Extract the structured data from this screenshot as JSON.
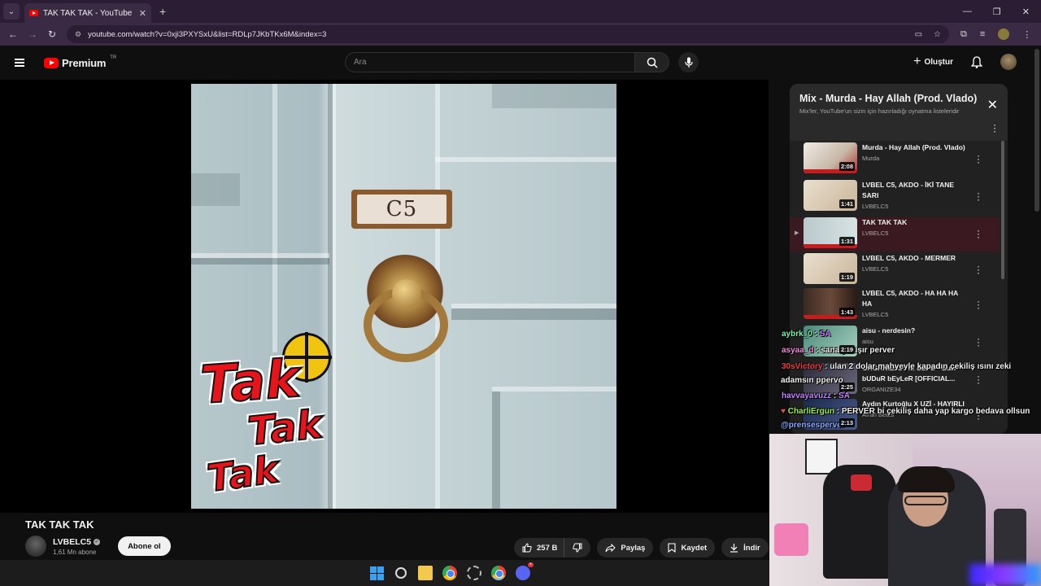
{
  "browser": {
    "tab_title": "TAK TAK TAK - YouTube",
    "url": "youtube.com/watch?v=0xji3PXYSxU&list=RDLp7JKbTKx6M&index=3"
  },
  "header": {
    "logo_text": "Premium",
    "logo_region": "TR",
    "search_placeholder": "Ara",
    "create_label": "Oluştur"
  },
  "cover": {
    "plate_text": "C5",
    "sticker_words": [
      "Tak",
      "Tak",
      "Tak"
    ]
  },
  "video": {
    "title": "TAK TAK TAK",
    "channel": "LVBELC5",
    "subscribers": "1,61 Mn abone",
    "subscribe_label": "Abone ol",
    "likes": "257 B",
    "share_label": "Paylaş",
    "save_label": "Kaydet",
    "download_label": "İndir"
  },
  "playlist": {
    "title": "Mix - Murda - Hay Allah (Prod. Vlado)",
    "subtitle": "Mix'ler, YouTube'un sizin için hazırladığı oynatma listeleridir",
    "items": [
      {
        "title": "Murda - Hay Allah (Prod. Vlado)",
        "channel": "Murda",
        "duration": "2:08"
      },
      {
        "title": "LVBEL C5, AKDO - İKİ TANE SARI",
        "channel": "LVBELC5",
        "duration": "1:41"
      },
      {
        "title": "TAK TAK TAK",
        "channel": "LVBELC5",
        "duration": "1:31"
      },
      {
        "title": "LVBEL C5, AKDO - MERMER",
        "channel": "LVBELC5",
        "duration": "1:19"
      },
      {
        "title": "LVBEL C5, AKDO - HA HA HA HA",
        "channel": "LVBELC5",
        "duration": "1:43"
      },
      {
        "title": "aisu - nerdesin?",
        "channel": "aisu",
        "duration": "2:19"
      },
      {
        "title": "ORGANIZE34 ft. SEFO - BuR bUDuR bEyLeR [OFFICIAL...",
        "channel": "ORGANIZE34",
        "duration": "2:25"
      },
      {
        "title": "Aydın Kurtoğlu X UZİ - HAYIRLI",
        "channel": "Afran Beats",
        "duration": "2:13"
      }
    ]
  },
  "chat": [
    {
      "user": "aybrk_0",
      "sep": " : ",
      "text": "SA",
      "color": "#7cf0b0"
    },
    {
      "user": "asyaa_d",
      "sep": " : ",
      "text": "sana yakışır perver",
      "color": "#f08ad8"
    },
    {
      "user": "30sVictory",
      "sep": " : ",
      "text": "ulan 2 dolar mahyeyle kapadın çekiliş ısını zeki",
      "color": "#f04040"
    },
    {
      "user": "",
      "sep": "",
      "text": "adamsın ppervo",
      "color": "#ffffff"
    },
    {
      "user": "havvayavuzz",
      "sep": " : ",
      "text": "SA",
      "color": "#c080ff"
    },
    {
      "user": "CharliErgun",
      "sep": " : ",
      "text": "PERVER bi çekiliş daha yap kargo bedava ollsun",
      "color": "#9bf04a"
    },
    {
      "user": "@prensesperver",
      "sep": "",
      "text": "",
      "color": "#8aa8ff"
    }
  ],
  "colors": {
    "accent": "#ff0000",
    "background": "#0f0f0f",
    "playlist_active": "#3a1a20"
  }
}
